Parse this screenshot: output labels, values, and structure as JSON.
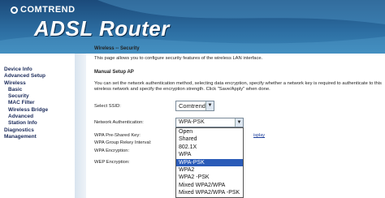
{
  "header": {
    "brand": "COMTREND",
    "product": "ADSL Router"
  },
  "sidebar": {
    "items": [
      {
        "label": "Device Info",
        "level": 1
      },
      {
        "label": "Advanced Setup",
        "level": 1
      },
      {
        "label": "Wireless",
        "level": 1
      },
      {
        "label": "Basic",
        "level": 2
      },
      {
        "label": "Security",
        "level": 2
      },
      {
        "label": "MAC Filter",
        "level": 2
      },
      {
        "label": "Wireless Bridge",
        "level": 2
      },
      {
        "label": "Advanced",
        "level": 2
      },
      {
        "label": "Station Info",
        "level": 2
      },
      {
        "label": "Diagnostics",
        "level": 1
      },
      {
        "label": "Management",
        "level": 1
      }
    ]
  },
  "main": {
    "title": "Wireless -- Security",
    "intro": "This page allows you to configure security features of the wireless LAN interface.",
    "section": "Manual Setup AP",
    "description": "You can set the network authentication method, selecting data encryption, specify whether a network key is required to authenticate to this wireless network and specify the encryption strength. Click \"Save/Apply\" when done.",
    "ssid_label": "Select SSID:",
    "ssid_value": "Comtrend",
    "auth_label": "Network Authentication:",
    "auth_value": "WPA-PSK",
    "psk_label": "WPA Pre-Shared Key:",
    "rekey_label": "WPA Group Rekey Interval:",
    "wpa_enc_label": "WPA Encryption:",
    "wep_enc_label": "WEP Encryption:",
    "display_link": "isplay",
    "auth_options": [
      "Open",
      "Shared",
      "802.1X",
      "WPA",
      "WPA-PSK",
      "WPA2",
      "WPA2 -PSK",
      "Mixed WPA2/WPA",
      "Mixed WPA2/WPA -PSK"
    ],
    "auth_selected_index": 4
  }
}
